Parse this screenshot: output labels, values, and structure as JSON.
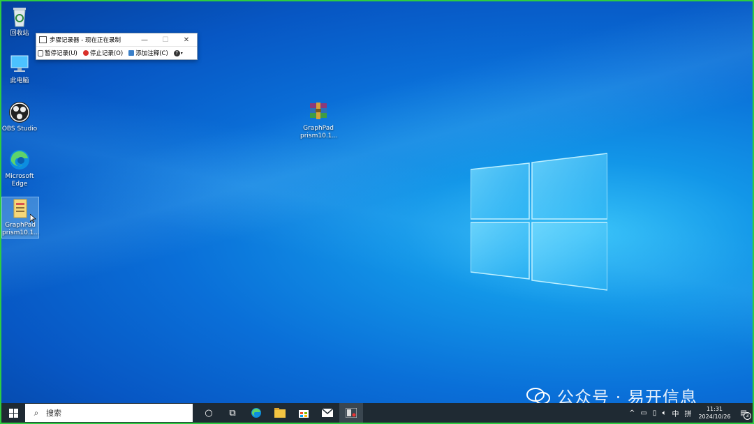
{
  "desktop": {
    "icons": [
      {
        "label": "回收站",
        "name": "recycle-bin"
      },
      {
        "label": "此电脑",
        "name": "this-pc"
      },
      {
        "label": "OBS Studio",
        "name": "obs-studio"
      },
      {
        "label": "Microsoft Edge",
        "name": "microsoft-edge"
      },
      {
        "label": "GraphPad prism10.1...",
        "name": "graphpad-prism-left"
      },
      {
        "label": "GraphPad prism10.1...",
        "name": "graphpad-prism-archive"
      }
    ]
  },
  "steps_recorder": {
    "title": "步骤记录器 - 现在正在录制",
    "minimize": "—",
    "maximize": "☐",
    "close": "✕",
    "pause": "暂停记录(U)",
    "stop": "停止记录(O)",
    "add_comment": "添加注释(C)",
    "help": "?"
  },
  "taskbar": {
    "search_placeholder": "搜索",
    "tray_caret": "^",
    "ime_lang": "中",
    "ime_mode": "拼",
    "time": "11:31",
    "date": "2024/10/26",
    "notification_count": "3"
  },
  "watermark": {
    "text": "公众号 · 易开信息"
  },
  "colors": {
    "accent": "#0a6fd8",
    "taskbar": "#1f2a33",
    "border": "#2ecc40"
  }
}
